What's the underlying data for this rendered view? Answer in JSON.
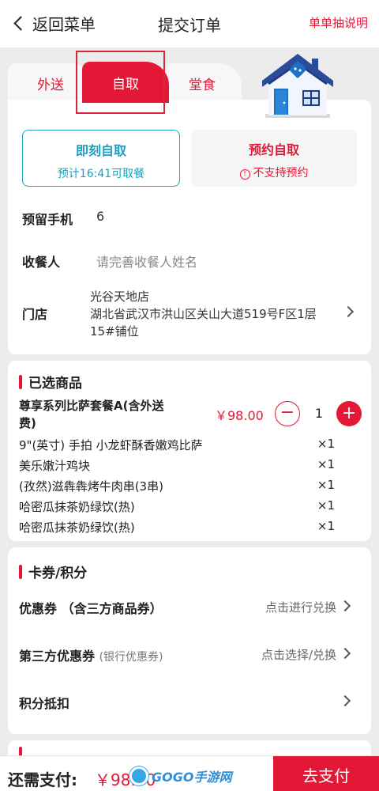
{
  "header": {
    "back_label": "返回菜单",
    "title": "提交订单",
    "help_link": "单单抽说明"
  },
  "tabs": {
    "delivery": "外送",
    "pickup": "自取",
    "dine_in": "堂食"
  },
  "pickup_options": {
    "now": {
      "title": "即刻自取",
      "subtitle": "预计16:41可取餐"
    },
    "reserve": {
      "title": "预约自取",
      "subtitle": "不支持预约"
    }
  },
  "form": {
    "phone_label": "预留手机",
    "phone_value": "6",
    "recipient_label": "收餐人",
    "recipient_placeholder": "请完善收餐人姓名",
    "store_label": "门店",
    "store_name": "光谷天地店",
    "store_address": "湖北省武汉市洪山区关山大道519号F区1层15#铺位"
  },
  "selected": {
    "title": "已选商品",
    "product": {
      "name": "尊享系列比萨套餐A(含外送费)",
      "price": "￥98.00",
      "qty": "1"
    },
    "items": [
      {
        "name": "9\"(英寸) 手拍 小龙虾酥香嫩鸡比萨",
        "count": "×1"
      },
      {
        "name": "美乐嫩汁鸡块",
        "count": "×1"
      },
      {
        "name": "(孜然)滋犇犇烤牛肉串(3串)",
        "count": "×1"
      },
      {
        "name": "哈密瓜抹茶奶绿饮(热)",
        "count": "×1"
      },
      {
        "name": "哈密瓜抹茶奶绿饮(热)",
        "count": "×1"
      }
    ]
  },
  "coupons": {
    "title": "卡券/积分",
    "rows": [
      {
        "label": "优惠券 （含三方商品券）",
        "sub": "",
        "action": "点击进行兑换"
      },
      {
        "label": "第三方优惠券",
        "sub": "(银行优惠券)",
        "action": "点击选择/兑换"
      },
      {
        "label": "积分抵扣",
        "sub": "",
        "action": ""
      }
    ]
  },
  "footer": {
    "pay_label": "还需支付:",
    "amount": "￥98.00",
    "pay_button": "去支付"
  },
  "watermark": {
    "text": "GOGO手游网"
  },
  "colors": {
    "accent": "#e31837",
    "teal": "#1a9fc2",
    "background": "#ececec"
  }
}
